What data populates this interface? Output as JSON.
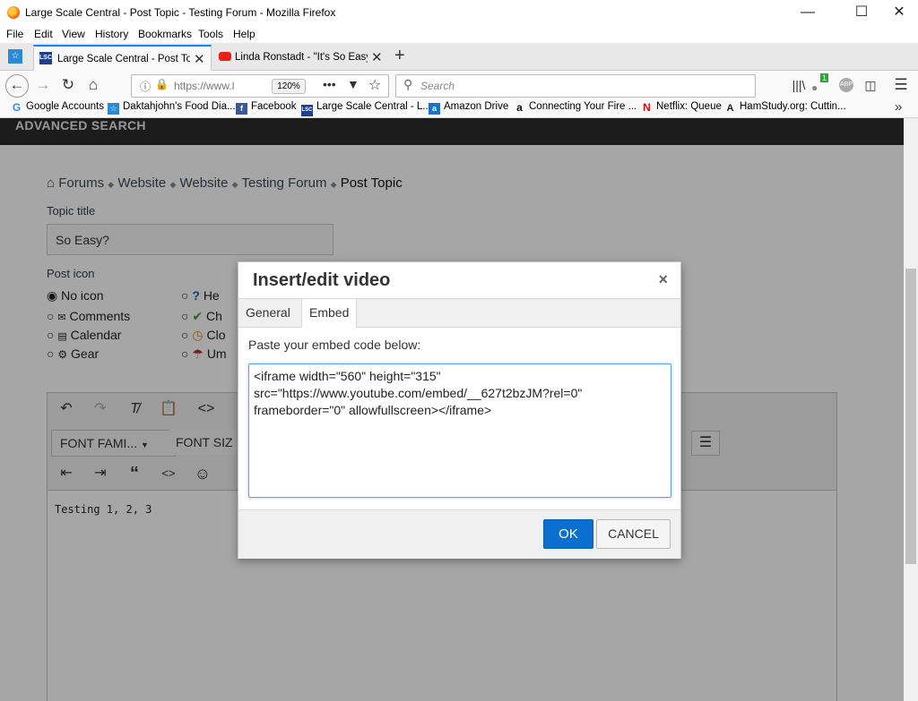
{
  "window": {
    "title": "Large Scale Central - Post Topic - Testing Forum - Mozilla Firefox"
  },
  "menu": [
    "File",
    "Edit",
    "View",
    "History",
    "Bookmarks",
    "Tools",
    "Help"
  ],
  "tabs": [
    {
      "label": "Large Scale Central - Post Topic"
    },
    {
      "label": "Linda Ronstadt - \"It's So Easy\" ("
    }
  ],
  "nav": {
    "url": "https://www.l",
    "zoom": "120%",
    "search_placeholder": "Search",
    "badge": "1"
  },
  "bookmarks": [
    "Google Accounts",
    "Daktahjohn's Food Dia...",
    "Facebook",
    "Large Scale Central - L...",
    "Amazon Drive",
    "Connecting Your Fire ...",
    "Netflix: Queue",
    "HamStudy.org: Cuttin..."
  ],
  "page": {
    "banner": "ADVANCED SEARCH",
    "breadcrumb": [
      "Forums",
      "Website",
      "Website",
      "Testing Forum",
      "Post Topic"
    ],
    "topic_title_label": "Topic title",
    "topic_title_value": "So Easy?",
    "post_icon_label": "Post icon",
    "icons_col1": [
      "No icon",
      "Comments",
      "Calendar",
      "Gear"
    ],
    "icons_col2": [
      "He",
      "Ch",
      "Clo",
      "Um"
    ],
    "toolbar": {
      "font_family": "FONT FAMI...",
      "font_size": "FONT SIZ"
    },
    "editor_text": "Testing 1, 2, 3"
  },
  "dialog": {
    "title": "Insert/edit video",
    "close": "×",
    "tabs": [
      "General",
      "Embed"
    ],
    "embed_label": "Paste your embed code below:",
    "embed_code": "<iframe width=\"560\" height=\"315\" src=\"https://www.youtube.com/embed/__627t2bzJM?rel=0\" frameborder=\"0\" allowfullscreen></iframe>",
    "ok": "OK",
    "cancel": "CANCEL"
  }
}
